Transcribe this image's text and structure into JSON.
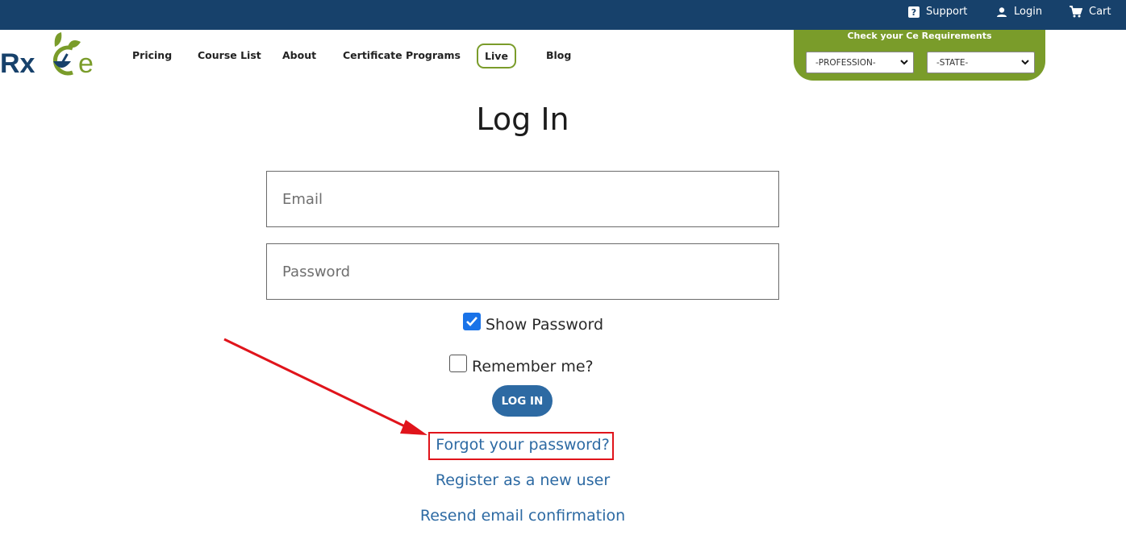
{
  "topbar": {
    "support_label": "Support",
    "login_label": "Login",
    "cart_label": "Cart",
    "background": "#17416b"
  },
  "logo": {
    "text_left": "Rx",
    "text_right": "e",
    "brand_blue": "#17416b",
    "brand_green": "#7a9c2a"
  },
  "nav": {
    "items": [
      "Pricing",
      "Course List",
      "About",
      "Certificate Programs",
      "Live",
      "Blog"
    ]
  },
  "ce_requirements": {
    "title": "Check your Ce Requirements",
    "profession_selected": "-PROFESSION-",
    "state_selected": "-STATE-"
  },
  "login_form": {
    "title": "Log In",
    "email_placeholder": "Email",
    "password_placeholder": "Password",
    "show_password_label": "Show Password",
    "show_password_checked": true,
    "remember_me_label": "Remember me?",
    "remember_me_checked": false,
    "submit_label": "LOG IN"
  },
  "links": {
    "forgot_password": "Forgot your password?",
    "register": "Register as a new user",
    "resend_confirmation": "Resend email confirmation"
  },
  "annotation": {
    "color": "#e0141b"
  }
}
